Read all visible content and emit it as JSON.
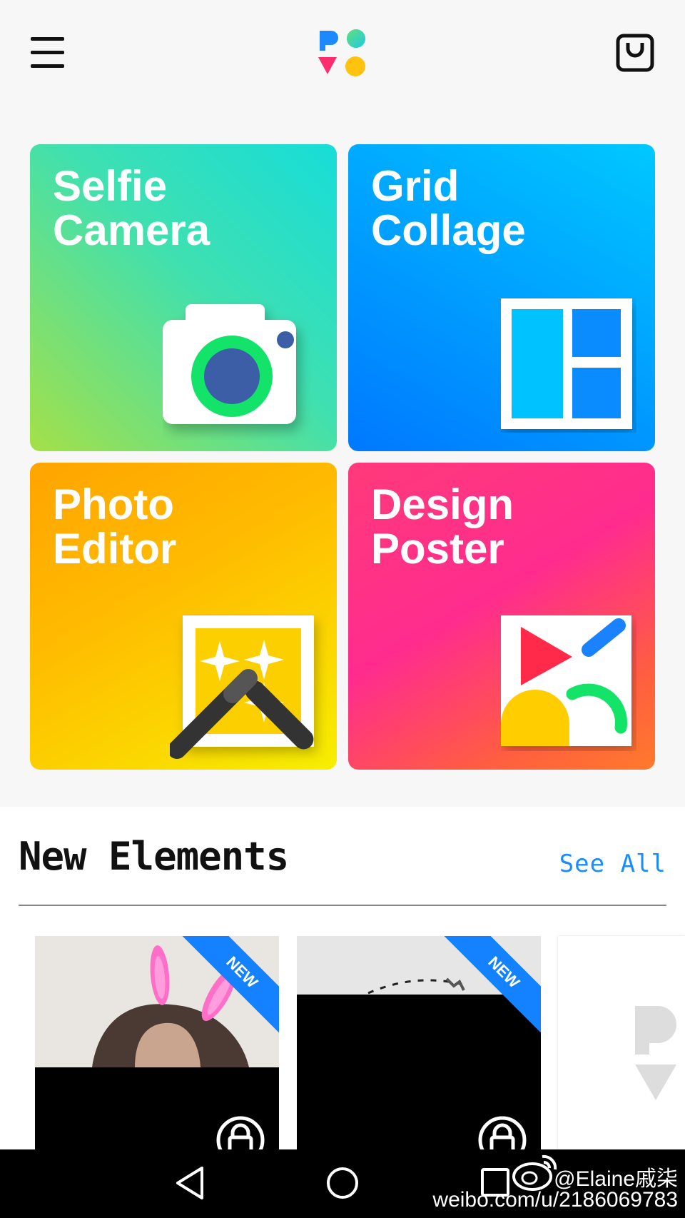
{
  "header": {
    "menu_icon": "hamburger-menu-icon",
    "logo": "app-logo",
    "bag_icon": "shopping-bag-icon"
  },
  "tiles": [
    {
      "title": "Selfie\nCamera",
      "icon": "camera-icon"
    },
    {
      "title": "Grid\nCollage",
      "icon": "grid-collage-icon"
    },
    {
      "title": "Photo\nEditor",
      "icon": "magic-wand-icon"
    },
    {
      "title": "Design\nPoster",
      "icon": "poster-shapes-icon"
    }
  ],
  "new_elements": {
    "title": "New Elements",
    "see_all": "See All",
    "cards": [
      {
        "badge": "NEW",
        "thumb": "bunny-ears-sticker",
        "lock": "lock-icon"
      },
      {
        "badge": "NEW",
        "thumb": "text-sticker",
        "lock": "lock-icon"
      },
      {
        "thumb": "logo-placeholder"
      }
    ]
  },
  "navbar": {
    "back": "back-icon",
    "home": "home-icon",
    "recent": "recent-apps-icon"
  },
  "watermark": {
    "user": "@Elaine戚柒",
    "url": "weibo.com/u/2186069783"
  },
  "colors": {
    "accent": "#1a8cff",
    "selfie": "#3fe0b0",
    "grid": "#00a4ff",
    "photo": "#ffbb00",
    "design": "#ff2c8e"
  }
}
